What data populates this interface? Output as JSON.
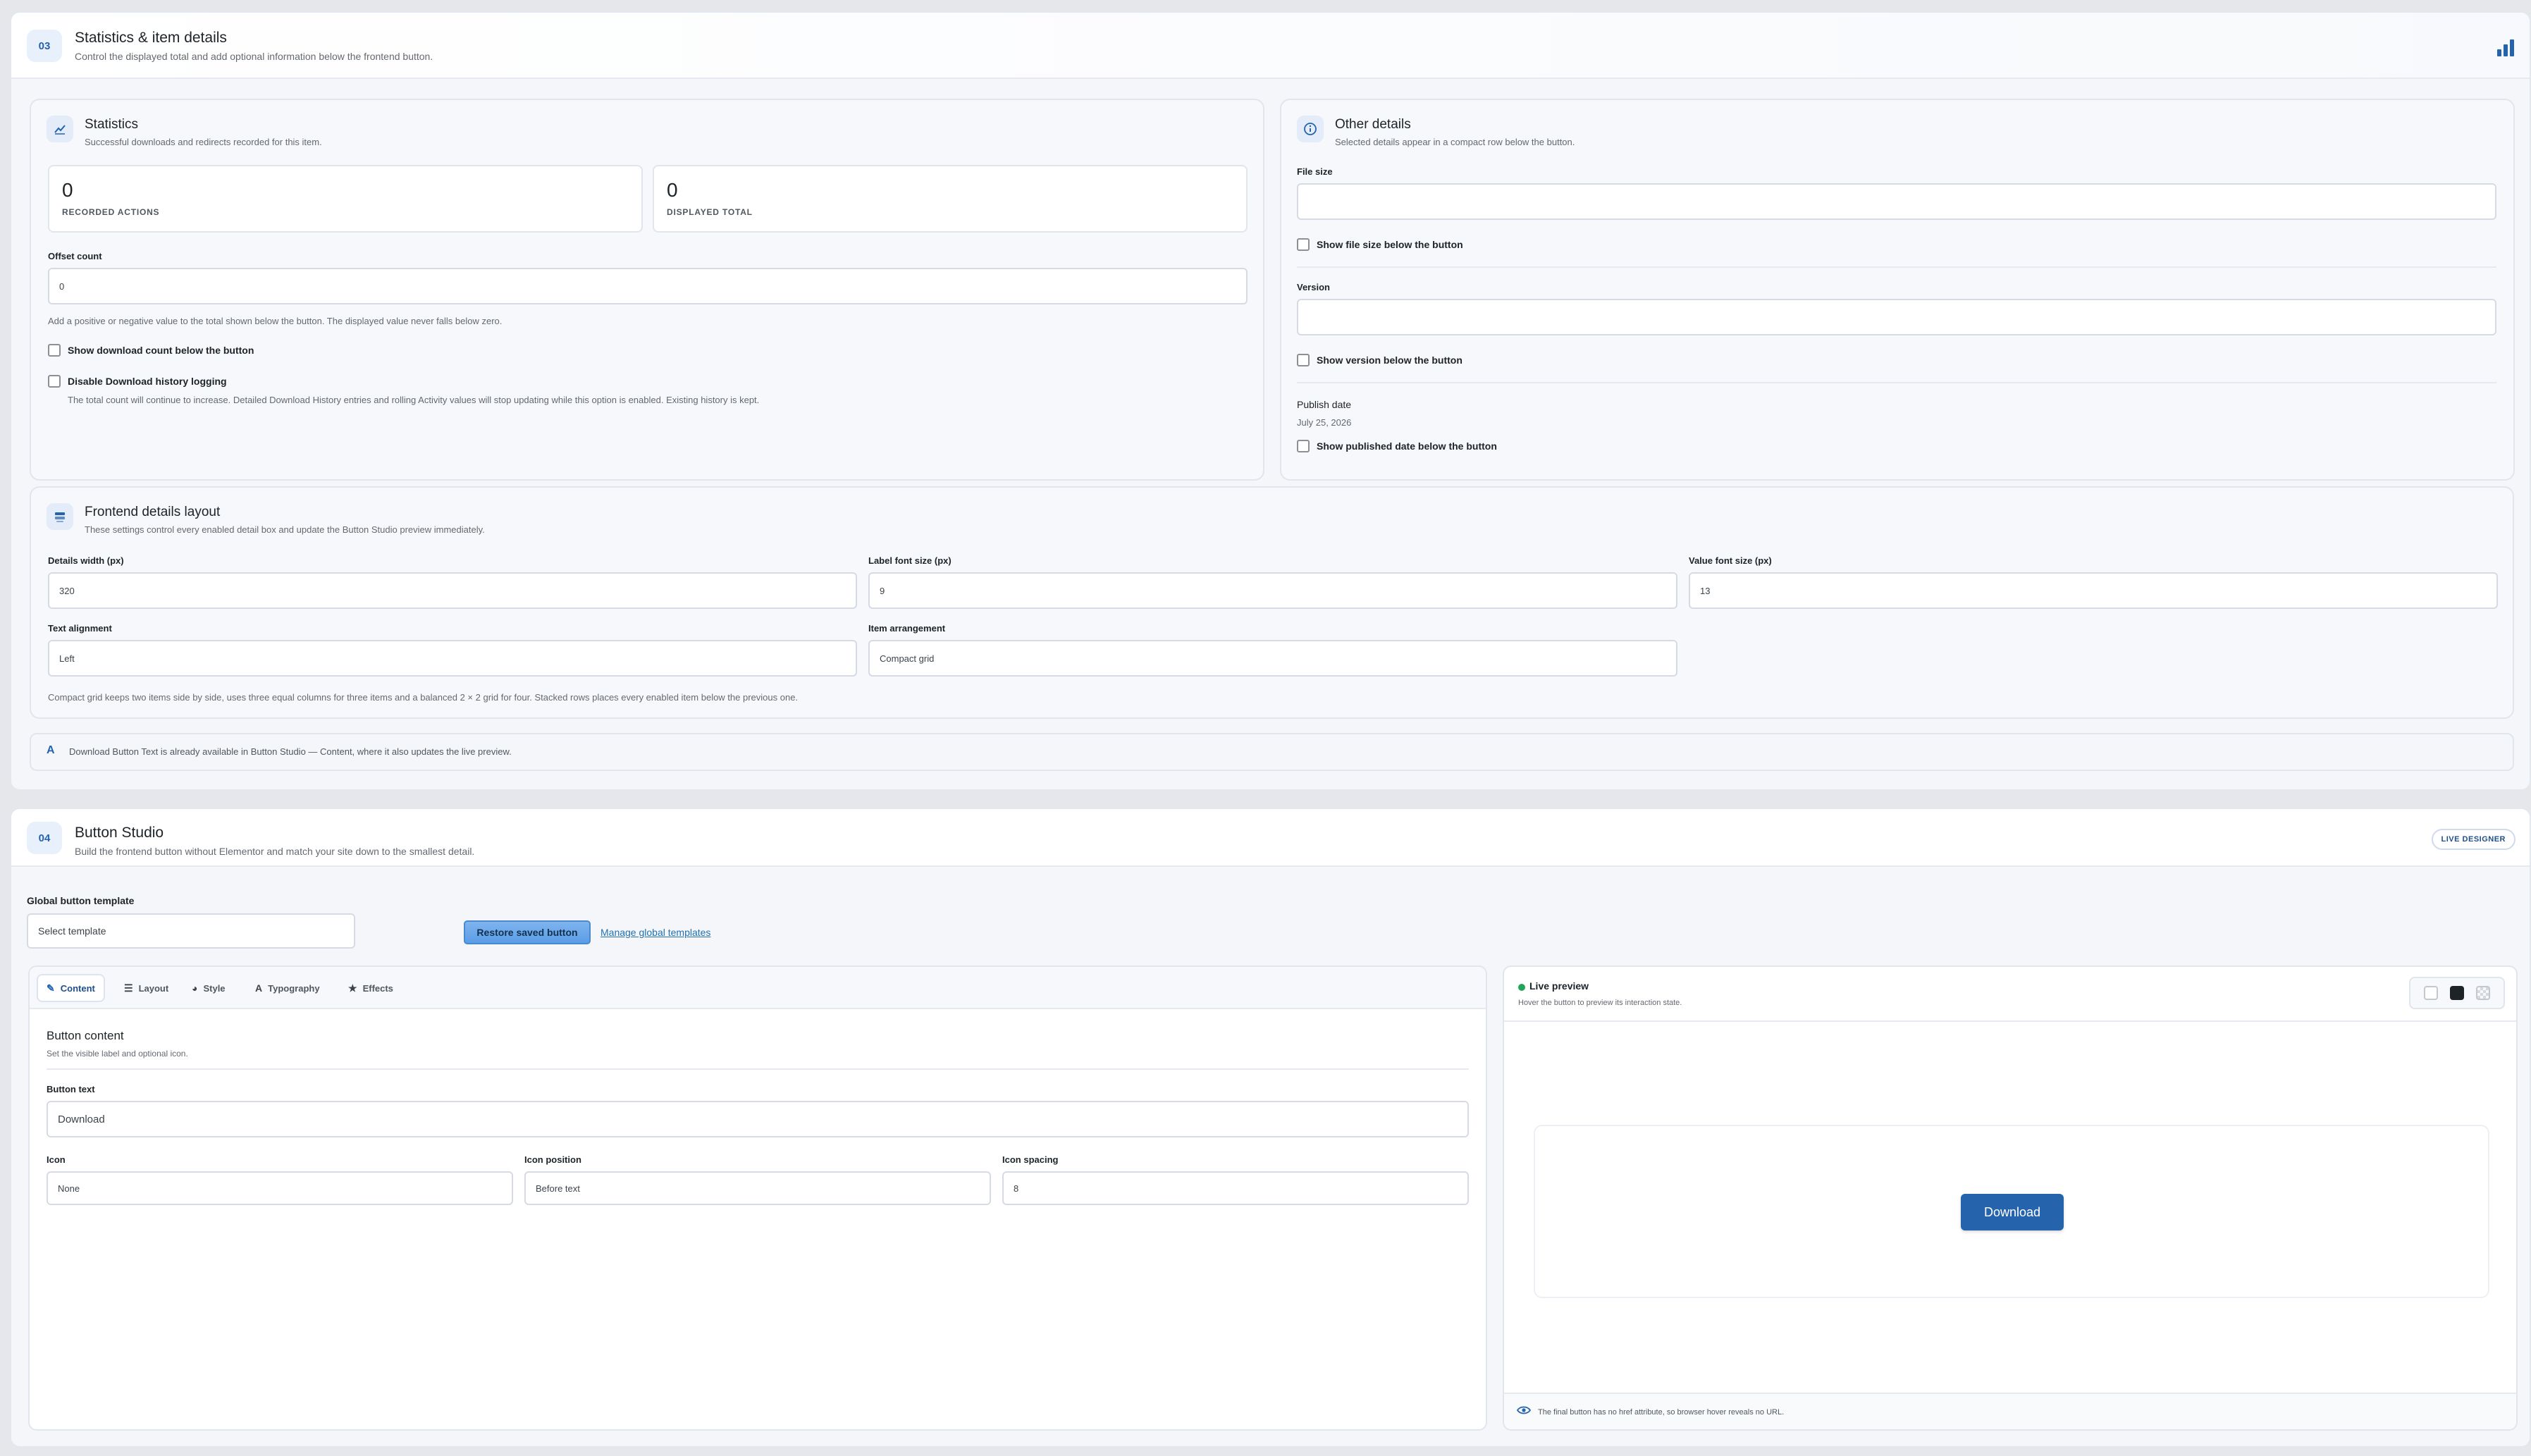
{
  "stats_section": {
    "number": "03",
    "title": "Statistics & item details",
    "subtitle": "Control the displayed total and add optional information below the frontend button.",
    "header_icon": "bar-chart-icon"
  },
  "statistics": {
    "title": "Statistics",
    "subtitle": "Successful downloads and redirects recorded for this item.",
    "recorded_value": "0",
    "recorded_label": "RECORDED ACTIONS",
    "displayed_value": "0",
    "displayed_label": "DISPLAYED TOTAL",
    "offset_label": "Offset count",
    "offset_value": "0",
    "offset_help": "Add a positive or negative value to the total shown below the button. The displayed value never falls below zero.",
    "show_count_label": "Show download count below the button",
    "disable_history_label": "Disable Download history logging",
    "disable_history_help": "The total count will continue to increase. Detailed Download History entries and rolling Activity values will stop updating while this option is enabled. Existing history is kept."
  },
  "other_details": {
    "title": "Other details",
    "subtitle": "Selected details appear in a compact row below the button.",
    "file_size_label": "File size",
    "file_size_value": "",
    "show_file_size_label": "Show file size below the button",
    "version_label": "Version",
    "version_value": "",
    "show_version_label": "Show version below the button",
    "publish_date_label": "Publish date",
    "publish_date_value": "July 25, 2026",
    "show_published_label": "Show published date below the button"
  },
  "frontend_layout": {
    "title": "Frontend details layout",
    "subtitle": "These settings control every enabled detail box and update the Button Studio preview immediately.",
    "details_width_label": "Details width (px)",
    "details_width_value": "320",
    "label_font_label": "Label font size (px)",
    "label_font_value": "9",
    "value_font_label": "Value font size (px)",
    "value_font_value": "13",
    "text_alignment_label": "Text alignment",
    "text_alignment_value": "Left",
    "item_arrangement_label": "Item arrangement",
    "item_arrangement_value": "Compact grid",
    "help": "Compact grid keeps two items side by side, uses three equal columns for three items and a balanced 2 × 2 grid for four. Stacked rows places every enabled item below the previous one."
  },
  "notice": {
    "icon": "A",
    "text": "Download Button Text is already available in Button Studio — Content, where it also updates the live preview."
  },
  "studio_section": {
    "number": "04",
    "title": "Button Studio",
    "subtitle": "Build the frontend button without Elementor and match your site down to the smallest detail.",
    "badge": "LIVE DESIGNER",
    "template_label": "Global button template",
    "template_value": "Select template",
    "restore_label": "Restore saved button",
    "manage_label": "Manage global templates"
  },
  "tabs": [
    {
      "label": "Content",
      "icon": "✎"
    },
    {
      "label": "Layout",
      "icon": "☰"
    },
    {
      "label": "Style",
      "icon": "◕"
    },
    {
      "label": "Typography",
      "icon": "A"
    },
    {
      "label": "Effects",
      "icon": "★"
    }
  ],
  "content_panel": {
    "title": "Button content",
    "subtitle": "Set the visible label and optional icon.",
    "button_text_label": "Button text",
    "button_text_value": "Download",
    "icon_label": "Icon",
    "icon_value": "None",
    "icon_position_label": "Icon position",
    "icon_position_value": "Before text",
    "icon_spacing_label": "Icon spacing",
    "icon_spacing_value": "8"
  },
  "preview": {
    "title": "Live preview",
    "subtitle": "Hover the button to preview its interaction state.",
    "button_label": "Download",
    "footer_note": "The final button has no href attribute, so browser hover reveals no URL."
  },
  "colors": {
    "accent": "#2563ad",
    "live_dot": "#22a55a"
  }
}
